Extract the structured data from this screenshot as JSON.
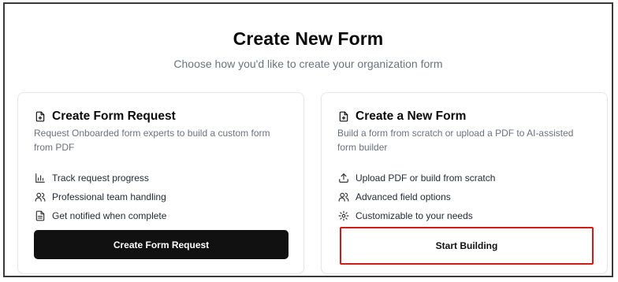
{
  "header": {
    "title": "Create New Form",
    "subtitle": "Choose how you'd like to create your organization form"
  },
  "cards": [
    {
      "icon": "file-plus-icon",
      "title": "Create Form Request",
      "description": "Request Onboarded form experts to build a custom form from PDF",
      "features": [
        {
          "icon": "bar-chart-icon",
          "label": "Track request progress"
        },
        {
          "icon": "users-icon",
          "label": "Professional team handling"
        },
        {
          "icon": "file-text-icon",
          "label": "Get notified when complete"
        }
      ],
      "button_label": "Create Form Request"
    },
    {
      "icon": "file-plus-icon",
      "title": "Create a New Form",
      "description": "Build a form from scratch or upload a PDF to AI-assisted form builder",
      "features": [
        {
          "icon": "upload-icon",
          "label": "Upload PDF or build from scratch"
        },
        {
          "icon": "users-icon",
          "label": "Advanced field options"
        },
        {
          "icon": "gear-icon",
          "label": "Customizable to your needs"
        }
      ],
      "button_label": "Start Building"
    }
  ],
  "colors": {
    "primary_button": "#111111",
    "highlight_border": "#d11a1a",
    "muted_text": "#6b7280"
  }
}
